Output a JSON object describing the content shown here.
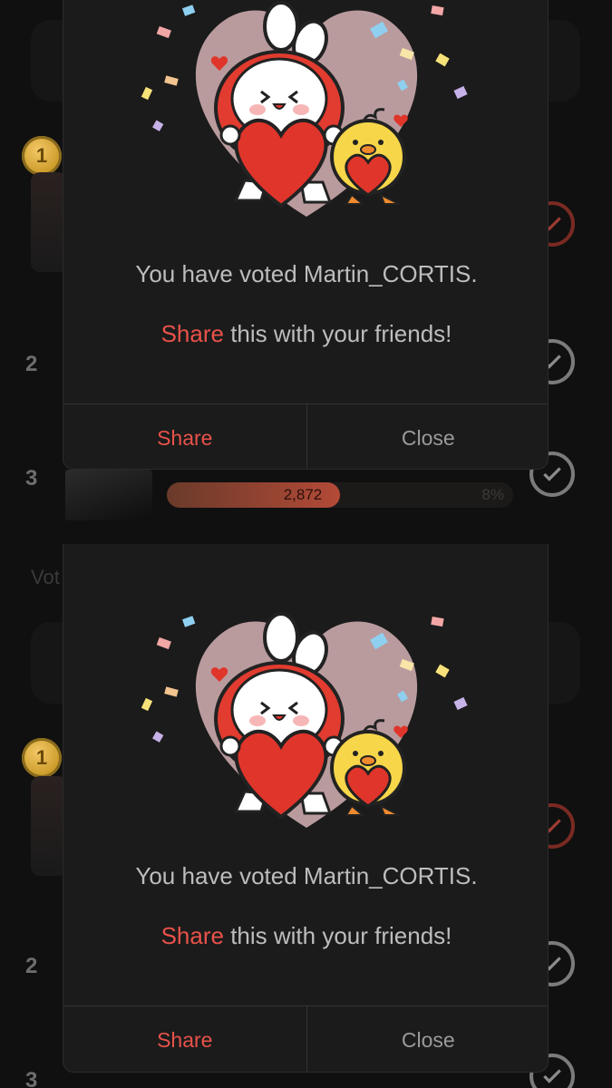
{
  "background_rows": {
    "medal_rank": "1",
    "rank_2": "2",
    "rank_3": "3",
    "row3_votes": "2,872",
    "row3_percent": "8%",
    "row3_fill_fraction": 0.5,
    "vote_ghost_text": "Vot"
  },
  "modal": {
    "message": "You have voted Martin_CORTIS.",
    "share_prompt_highlight": "Share",
    "share_prompt_rest": " this with your friends!",
    "share_button": "Share",
    "close_button": "Close"
  },
  "colors": {
    "accent": "#e8524a",
    "heart": "#e0352b",
    "bunny_hood": "#e23b2f",
    "chick": "#f7d64a"
  }
}
